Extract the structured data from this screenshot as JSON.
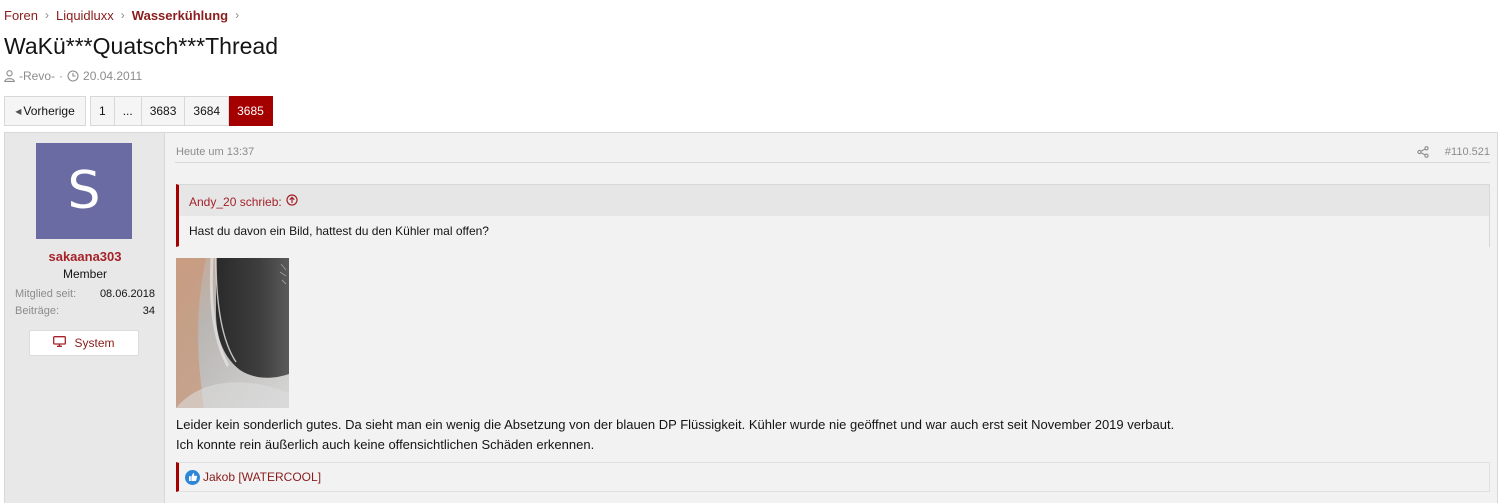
{
  "breadcrumb": {
    "items": [
      "Foren",
      "Liquidluxx",
      "Wasserkühlung"
    ],
    "separator": ">"
  },
  "thread": {
    "title": "WaKü***Quatsch***Thread",
    "author": "-Revo-",
    "dot": "·",
    "date": "20.04.2011"
  },
  "pagination": {
    "prev_label": "Vorherige",
    "pages": [
      "1",
      "...",
      "3683",
      "3684",
      "3685"
    ],
    "current": "3685"
  },
  "post": {
    "user": {
      "avatar_letter": "S",
      "username": "sakaana303",
      "title": "Member",
      "stats": [
        {
          "label": "Mitglied seit:",
          "value": "08.06.2018"
        },
        {
          "label": "Beiträge:",
          "value": "34"
        }
      ],
      "system_label": "System"
    },
    "date": "Heute um 13:37",
    "number": "#110.521",
    "quote": {
      "author_line": "Andy_20 schrieb:",
      "text": "Hast du davon ein Bild, hattest du den Kühler mal offen?"
    },
    "body": [
      "Leider kein sonderlich gutes. Da sieht man ein wenig die Absetzung von der blauen DP Flüssigkeit. Kühler wurde nie geöffnet und war auch erst seit November 2019 verbaut.",
      "Ich konnte rein äußerlich auch keine offensichtlichen Schäden erkennen."
    ],
    "reactions": {
      "users": "Jakob [WATERCOOL]"
    }
  },
  "colors": {
    "accent": "#a50000",
    "link": "#8a1c1c",
    "avatar_bg": "#6b6ba3",
    "like_blue": "#2f86d9"
  },
  "icons": [
    "user-icon",
    "clock-icon",
    "chevron-right-icon",
    "triangle-left-icon",
    "monitor-icon",
    "share-icon",
    "arrow-up-circle-icon",
    "thumbs-up-icon"
  ]
}
